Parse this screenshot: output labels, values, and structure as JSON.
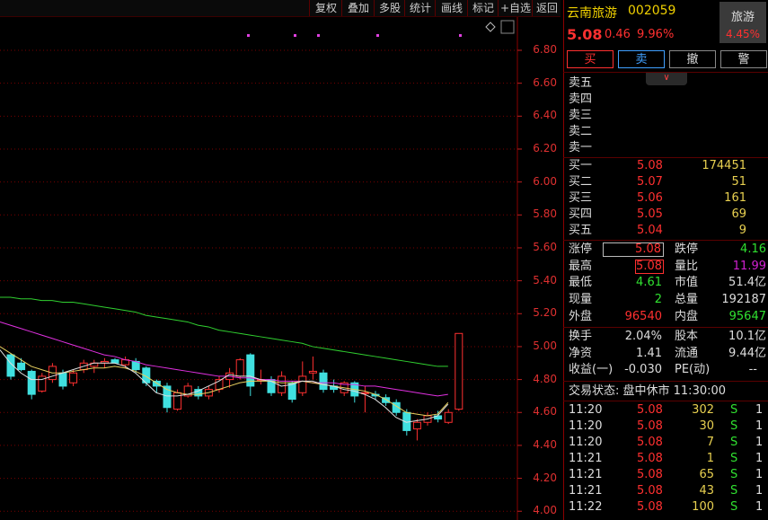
{
  "toolbar": {
    "buttons": [
      "复权",
      "叠加",
      "多股",
      "统计",
      "画线",
      "标记",
      "+自选",
      "返回"
    ]
  },
  "stock": {
    "name": "云南旅游",
    "code": "002059",
    "price": "5.08",
    "change": "0.46",
    "pct": "9.96%",
    "sector_name": "旅游",
    "sector_pct": "4.45%"
  },
  "actions": {
    "buy": "买",
    "sell": "卖",
    "cancel": "撤",
    "alert": "警"
  },
  "expand_icon": "chevron-double-down-icon",
  "ask": [
    {
      "label": "卖五",
      "price": "",
      "vol": ""
    },
    {
      "label": "卖四",
      "price": "",
      "vol": ""
    },
    {
      "label": "卖三",
      "price": "",
      "vol": ""
    },
    {
      "label": "卖二",
      "price": "",
      "vol": ""
    },
    {
      "label": "卖一",
      "price": "",
      "vol": ""
    }
  ],
  "bid": [
    {
      "label": "买一",
      "price": "5.08",
      "vol": "174451"
    },
    {
      "label": "买二",
      "price": "5.07",
      "vol": "51"
    },
    {
      "label": "买三",
      "price": "5.06",
      "vol": "161"
    },
    {
      "label": "买四",
      "price": "5.05",
      "vol": "69"
    },
    {
      "label": "买五",
      "price": "5.04",
      "vol": "9"
    }
  ],
  "stats": {
    "limit_up_label": "涨停",
    "limit_up": "5.08",
    "limit_down_label": "跌停",
    "limit_down": "4.16",
    "high_label": "最高",
    "high": "5.08",
    "vol_ratio_label": "量比",
    "vol_ratio": "11.99",
    "low_label": "最低",
    "low": "4.61",
    "mktcap_label": "市值",
    "mktcap": "51.4亿",
    "cur_label": "现量",
    "cur": "2",
    "total_label": "总量",
    "total": "192187",
    "outer_label": "外盘",
    "outer": "96540",
    "inner_label": "内盘",
    "inner": "95647",
    "turnover_label": "换手",
    "turnover": "2.04%",
    "equity_label": "股本",
    "equity": "10.1亿",
    "nav_label": "净资",
    "nav": "1.41",
    "float_label": "流通",
    "float": "9.44亿",
    "eps_label": "收益(一)",
    "eps": "-0.030",
    "pe_label": "PE(动)",
    "pe": "--"
  },
  "status": {
    "text": "交易状态: 盘中休市 11:30:00"
  },
  "ticks": [
    {
      "time": "11:20",
      "price": "5.08",
      "vol": "302",
      "side": "S",
      "n": "1"
    },
    {
      "time": "11:20",
      "price": "5.08",
      "vol": "30",
      "side": "S",
      "n": "1"
    },
    {
      "time": "11:20",
      "price": "5.08",
      "vol": "7",
      "side": "S",
      "n": "1"
    },
    {
      "time": "11:21",
      "price": "5.08",
      "vol": "1",
      "side": "S",
      "n": "1"
    },
    {
      "time": "11:21",
      "price": "5.08",
      "vol": "65",
      "side": "S",
      "n": "1"
    },
    {
      "time": "11:21",
      "price": "5.08",
      "vol": "43",
      "side": "S",
      "n": "1"
    },
    {
      "time": "11:22",
      "price": "5.08",
      "vol": "100",
      "side": "S",
      "n": "1"
    }
  ],
  "chart_data": {
    "type": "candlestick",
    "ylim": [
      4.0,
      6.9
    ],
    "yticks": [
      "6.80",
      "6.60",
      "6.40",
      "6.20",
      "6.00",
      "5.80",
      "5.60",
      "5.40",
      "5.20",
      "5.00",
      "4.80",
      "4.60",
      "4.40",
      "4.20",
      "4.00"
    ],
    "candles": [
      {
        "o": 4.95,
        "h": 4.96,
        "l": 4.8,
        "c": 4.82
      },
      {
        "o": 4.9,
        "h": 4.93,
        "l": 4.85,
        "c": 4.86
      },
      {
        "o": 4.85,
        "h": 4.86,
        "l": 4.68,
        "c": 4.71
      },
      {
        "o": 4.73,
        "h": 4.84,
        "l": 4.72,
        "c": 4.82
      },
      {
        "o": 4.8,
        "h": 4.9,
        "l": 4.78,
        "c": 4.88
      },
      {
        "o": 4.84,
        "h": 4.86,
        "l": 4.74,
        "c": 4.76
      },
      {
        "o": 4.78,
        "h": 4.86,
        "l": 4.76,
        "c": 4.84
      },
      {
        "o": 4.86,
        "h": 4.92,
        "l": 4.84,
        "c": 4.9
      },
      {
        "o": 4.88,
        "h": 4.92,
        "l": 4.84,
        "c": 4.9
      },
      {
        "o": 4.9,
        "h": 4.93,
        "l": 4.87,
        "c": 4.91
      },
      {
        "o": 4.92,
        "h": 4.93,
        "l": 4.9,
        "c": 4.9
      },
      {
        "o": 4.89,
        "h": 4.94,
        "l": 4.87,
        "c": 4.92
      },
      {
        "o": 4.91,
        "h": 4.93,
        "l": 4.84,
        "c": 4.86
      },
      {
        "o": 4.87,
        "h": 4.88,
        "l": 4.76,
        "c": 4.78
      },
      {
        "o": 4.79,
        "h": 4.8,
        "l": 4.72,
        "c": 4.76
      },
      {
        "o": 4.76,
        "h": 4.78,
        "l": 4.6,
        "c": 4.63
      },
      {
        "o": 4.62,
        "h": 4.74,
        "l": 4.61,
        "c": 4.72
      },
      {
        "o": 4.7,
        "h": 4.78,
        "l": 4.69,
        "c": 4.76
      },
      {
        "o": 4.74,
        "h": 4.76,
        "l": 4.68,
        "c": 4.7
      },
      {
        "o": 4.7,
        "h": 4.76,
        "l": 4.68,
        "c": 4.74
      },
      {
        "o": 4.74,
        "h": 4.82,
        "l": 4.72,
        "c": 4.8
      },
      {
        "o": 4.8,
        "h": 4.87,
        "l": 4.75,
        "c": 4.84
      },
      {
        "o": 4.82,
        "h": 4.93,
        "l": 4.8,
        "c": 4.92
      },
      {
        "o": 4.95,
        "h": 4.96,
        "l": 4.7,
        "c": 4.76
      },
      {
        "o": 4.8,
        "h": 4.86,
        "l": 4.77,
        "c": 4.8
      },
      {
        "o": 4.8,
        "h": 4.82,
        "l": 4.7,
        "c": 4.72
      },
      {
        "o": 4.72,
        "h": 4.85,
        "l": 4.7,
        "c": 4.82
      },
      {
        "o": 4.78,
        "h": 4.79,
        "l": 4.66,
        "c": 4.68
      },
      {
        "o": 4.72,
        "h": 4.91,
        "l": 4.7,
        "c": 4.82
      },
      {
        "o": 4.84,
        "h": 4.94,
        "l": 4.8,
        "c": 4.85
      },
      {
        "o": 4.84,
        "h": 4.86,
        "l": 4.72,
        "c": 4.74
      },
      {
        "o": 4.76,
        "h": 4.8,
        "l": 4.72,
        "c": 4.74
      },
      {
        "o": 4.72,
        "h": 4.79,
        "l": 4.7,
        "c": 4.78
      },
      {
        "o": 4.78,
        "h": 4.79,
        "l": 4.66,
        "c": 4.7
      },
      {
        "o": 4.72,
        "h": 4.76,
        "l": 4.6,
        "c": 4.72
      },
      {
        "o": 4.71,
        "h": 4.73,
        "l": 4.68,
        "c": 4.7
      },
      {
        "o": 4.69,
        "h": 4.71,
        "l": 4.64,
        "c": 4.66
      },
      {
        "o": 4.66,
        "h": 4.68,
        "l": 4.58,
        "c": 4.6
      },
      {
        "o": 4.6,
        "h": 4.62,
        "l": 4.46,
        "c": 4.49
      },
      {
        "o": 4.5,
        "h": 4.56,
        "l": 4.43,
        "c": 4.54
      },
      {
        "o": 4.54,
        "h": 4.6,
        "l": 4.52,
        "c": 4.58
      },
      {
        "o": 4.58,
        "h": 4.61,
        "l": 4.54,
        "c": 4.56
      },
      {
        "o": 4.54,
        "h": 4.62,
        "l": 4.53,
        "c": 4.6
      },
      {
        "o": 4.62,
        "h": 5.08,
        "l": 4.61,
        "c": 5.08
      }
    ],
    "ma_long": [
      5.3,
      5.3,
      5.29,
      5.29,
      5.28,
      5.28,
      5.27,
      5.27,
      5.26,
      5.25,
      5.24,
      5.23,
      5.22,
      5.21,
      5.19,
      5.18,
      5.17,
      5.16,
      5.15,
      5.13,
      5.12,
      5.1,
      5.09,
      5.08,
      5.07,
      5.06,
      5.05,
      5.04,
      5.03,
      5.02,
      5.0,
      4.99,
      4.98,
      4.97,
      4.96,
      4.95,
      4.94,
      4.93,
      4.92,
      4.91,
      4.9,
      4.89,
      4.88,
      4.88
    ],
    "ma_mid": [
      5.15,
      5.13,
      5.11,
      5.09,
      5.07,
      5.05,
      5.03,
      5.01,
      4.99,
      4.97,
      4.95,
      4.94,
      4.92,
      4.91,
      4.89,
      4.88,
      4.87,
      4.86,
      4.85,
      4.84,
      4.83,
      4.82,
      4.82,
      4.81,
      4.81,
      4.8,
      4.8,
      4.79,
      4.79,
      4.79,
      4.78,
      4.78,
      4.78,
      4.77,
      4.77,
      4.76,
      4.76,
      4.75,
      4.74,
      4.73,
      4.72,
      4.71,
      4.7,
      4.71
    ],
    "ma_short": [
      5.0,
      4.96,
      4.92,
      4.88,
      4.86,
      4.84,
      4.84,
      4.85,
      4.86,
      4.87,
      4.87,
      4.88,
      4.87,
      4.85,
      4.82,
      4.78,
      4.74,
      4.72,
      4.71,
      4.71,
      4.72,
      4.74,
      4.76,
      4.78,
      4.79,
      4.79,
      4.79,
      4.78,
      4.78,
      4.79,
      4.78,
      4.77,
      4.76,
      4.75,
      4.74,
      4.73,
      4.71,
      4.68,
      4.64,
      4.6,
      4.59,
      4.58,
      4.59,
      4.66
    ],
    "ma_fast": [
      4.98,
      4.9,
      4.84,
      4.8,
      4.8,
      4.82,
      4.84,
      4.86,
      4.88,
      4.9,
      4.9,
      4.9,
      4.88,
      4.84,
      4.78,
      4.72,
      4.7,
      4.7,
      4.71,
      4.73,
      4.76,
      4.79,
      4.83,
      4.82,
      4.82,
      4.8,
      4.79,
      4.76,
      4.77,
      4.79,
      4.79,
      4.77,
      4.76,
      4.74,
      4.73,
      4.71,
      4.68,
      4.63,
      4.57,
      4.54,
      4.55,
      4.56,
      4.58,
      4.65
    ]
  }
}
